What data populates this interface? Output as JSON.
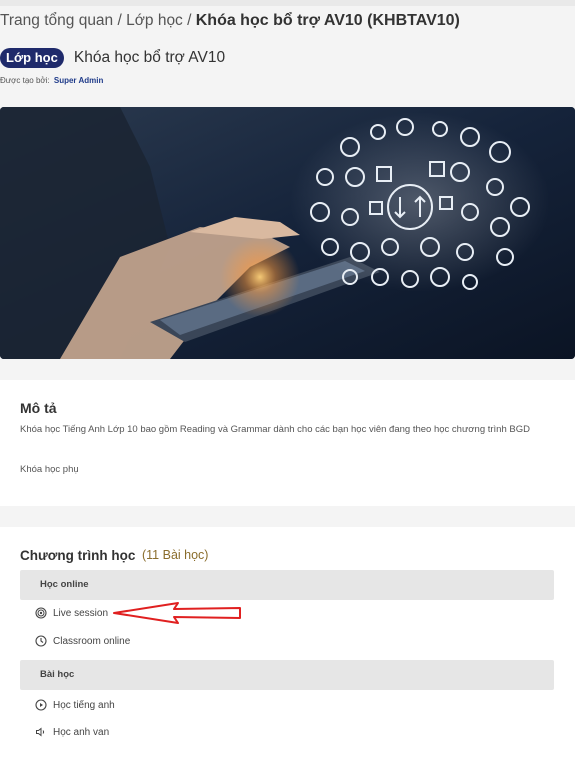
{
  "breadcrumb": {
    "home": "Trang tổng quan",
    "sep": " / ",
    "parent": "Lớp học",
    "current": "Khóa học bổ trợ AV10 (KHBTAV10)"
  },
  "course": {
    "badge": "Lớp học",
    "name": "Khóa học bổ trợ AV10",
    "created_by_label": "Được tạo bởi:",
    "created_by": "Super Admin"
  },
  "description": {
    "title": "Mô tả",
    "text": "Khóa học Tiếng Anh Lớp 10 bao gồm Reading và Grammar dành cho các bạn học viên đang theo học chương trình BGD",
    "extra": "Khóa học phụ"
  },
  "program": {
    "title": "Chương trình học",
    "count": "(11 Bài học)",
    "sections": [
      {
        "name": "Học online",
        "lessons": [
          {
            "label": "Live session",
            "icon": "live-target-icon"
          },
          {
            "label": "Classroom online",
            "icon": "clock-icon"
          }
        ]
      },
      {
        "name": "Bài học",
        "lessons": [
          {
            "label": "Học tiếng anh",
            "icon": "play-circle-icon"
          },
          {
            "label": "Học anh van",
            "icon": "speaker-icon"
          }
        ]
      }
    ]
  },
  "colors": {
    "badge_bg": "#1f2a6b",
    "count_text": "#8a6d2c",
    "arrow": "#e02020"
  }
}
